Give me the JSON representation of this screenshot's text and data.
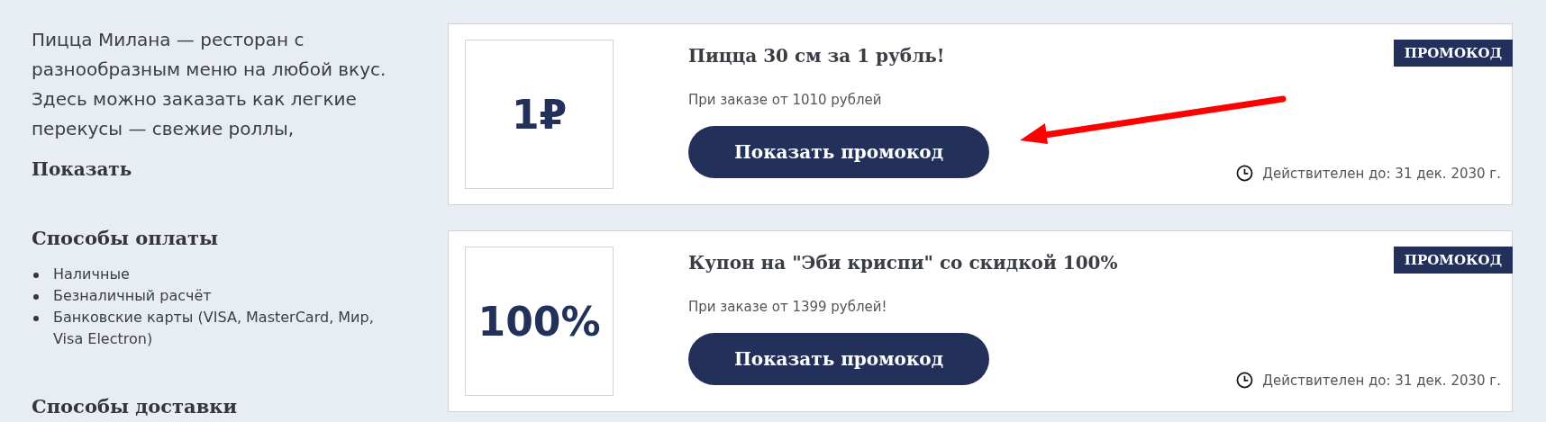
{
  "description": "Пицца Милана — ресторан с разнообразным меню на любой вкус. Здесь можно заказать как легкие перекусы — свежие роллы,",
  "show_more": "Показать",
  "sections": [
    {
      "title": "Способы оплаты",
      "items": [
        "Наличные",
        "Безналичный расчёт",
        "Банковские карты (VISA, MasterCard, Мир, Visa Electron)"
      ]
    },
    {
      "title": "Способы доставки"
    }
  ],
  "offers": [
    {
      "value": "1₽",
      "title": "Пицца 30 см за 1 рубль!",
      "condition": "При заказе от 1010 рублей",
      "button": "Показать промокод",
      "badge": "ПРОМОКОД",
      "expiry": "Действителен до: 31 дек. 2030 г."
    },
    {
      "value": "100%",
      "title": "Купон на \"Эби криспи\" со скидкой 100%",
      "condition": "При заказе от 1399 рублей!",
      "button": "Показать промокод",
      "badge": "ПРОМОКОД",
      "expiry": "Действителен до: 31 дек. 2030 г."
    }
  ]
}
